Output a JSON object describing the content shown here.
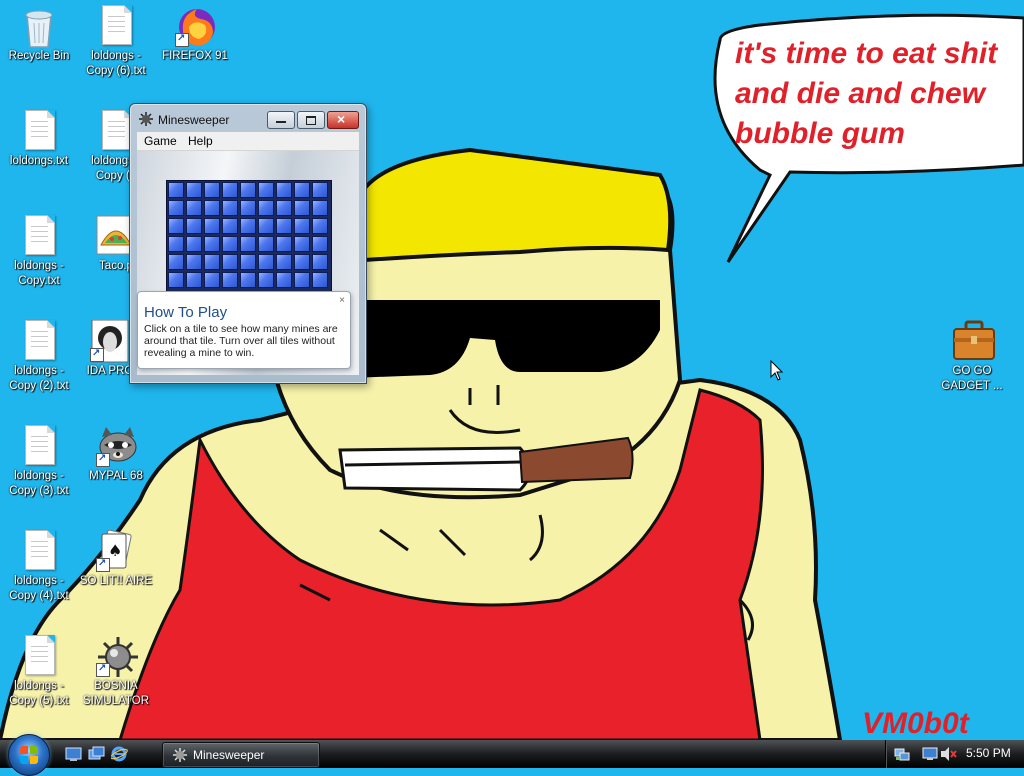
{
  "desktop": {
    "icons": [
      {
        "label": "Recycle Bin"
      },
      {
        "label": "loldongs - Copy (6).txt"
      },
      {
        "label": "FIREFOX 91"
      },
      {
        "label": "loldongs.txt"
      },
      {
        "label": "loldongs - Copy (7"
      },
      {
        "label": "loldongs - Copy.txt"
      },
      {
        "label": "Taco.p"
      },
      {
        "label": "loldongs - Copy (2).txt"
      },
      {
        "label": "IDA PRO"
      },
      {
        "label": "loldongs - Copy (3).txt"
      },
      {
        "label": "MYPAL 68"
      },
      {
        "label": "loldongs - Copy (4).txt"
      },
      {
        "label": "SO LIT!! AIRE"
      },
      {
        "label": "loldongs - Copy (5).txt"
      },
      {
        "label": "BOSNIA SIMULATOR"
      },
      {
        "label": "GO GO GADGET ..."
      }
    ]
  },
  "wallpaper": {
    "speech_lines": [
      "it's time to eat shit",
      "and die and chew",
      "bubble gum"
    ],
    "signature": "VM0b0t"
  },
  "window": {
    "title": "Minesweeper",
    "menu": [
      "Game",
      "Help"
    ],
    "board": {
      "rows": 6,
      "cols": 9
    },
    "tooltip": {
      "title": "How To Play",
      "body": "Click on a tile to see how many mines are around that tile. Turn over all tiles without revealing a mine to win.",
      "close": "×"
    }
  },
  "taskbar": {
    "task_label": "Minesweeper",
    "clock": "5:50 PM"
  },
  "colors": {
    "desktop_bg": "#1fb6ee",
    "tile_blue": "#2d56d2",
    "speech_red": "#e0212a"
  }
}
